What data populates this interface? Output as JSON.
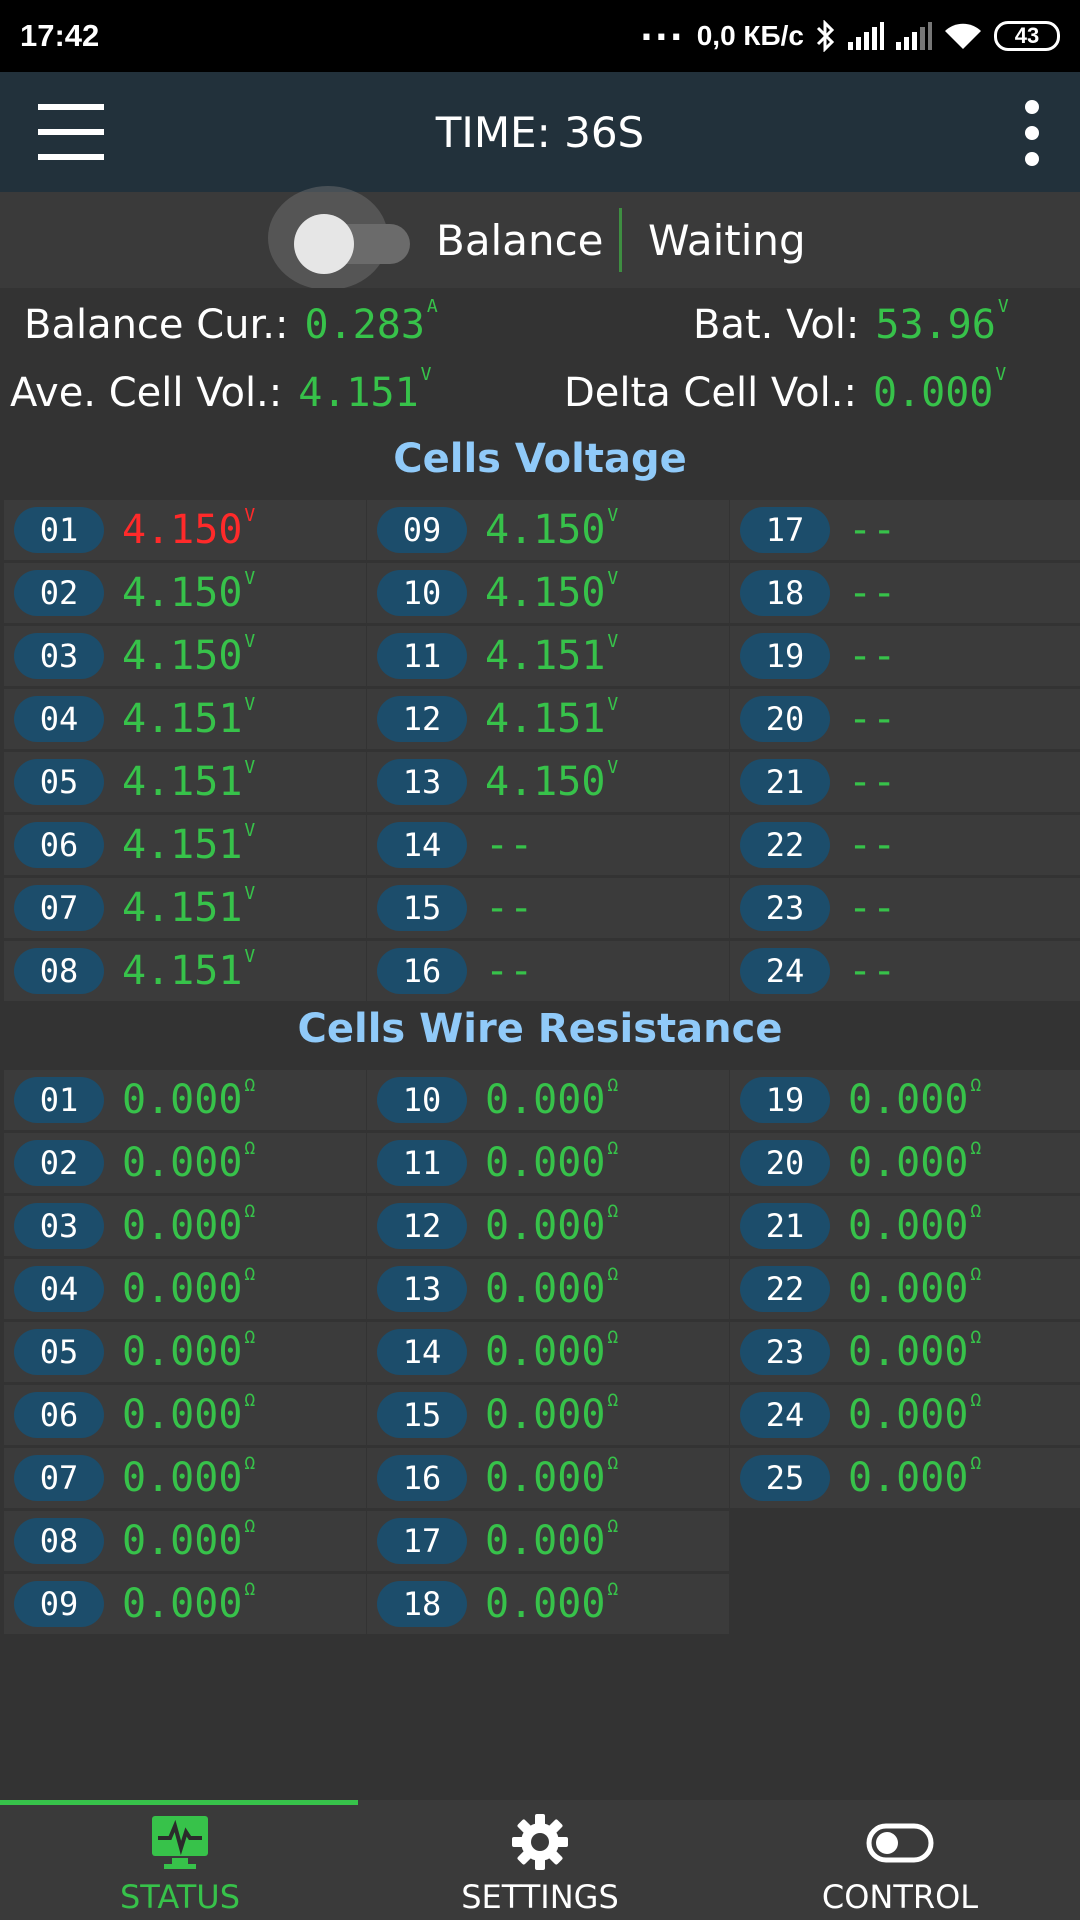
{
  "status_bar": {
    "time": "17:42",
    "dots": "...",
    "speed": "0,0 КБ/с",
    "battery": "43"
  },
  "app_bar": {
    "title": "TIME: 36S"
  },
  "balance": {
    "label": "Balance",
    "state": "Waiting",
    "switch_on": false
  },
  "stats": {
    "balance_cur": {
      "label": "Balance Cur.:",
      "value": "0.283",
      "unit": "A"
    },
    "bat_vol": {
      "label": "Bat. Vol:",
      "value": "53.96",
      "unit": "V"
    },
    "ave_cell_vol": {
      "label": "Ave. Cell Vol.:",
      "value": "4.151",
      "unit": "V"
    },
    "delta_cell_vol": {
      "label": "Delta Cell Vol.:",
      "value": "0.000",
      "unit": "V"
    }
  },
  "cells_voltage": {
    "title": "Cells Voltage",
    "unit": "V",
    "cells": [
      {
        "id": "01",
        "value": "4.150",
        "alert": true
      },
      {
        "id": "02",
        "value": "4.150"
      },
      {
        "id": "03",
        "value": "4.150"
      },
      {
        "id": "04",
        "value": "4.151"
      },
      {
        "id": "05",
        "value": "4.151"
      },
      {
        "id": "06",
        "value": "4.151"
      },
      {
        "id": "07",
        "value": "4.151"
      },
      {
        "id": "08",
        "value": "4.151"
      },
      {
        "id": "09",
        "value": "4.150"
      },
      {
        "id": "10",
        "value": "4.150"
      },
      {
        "id": "11",
        "value": "4.151"
      },
      {
        "id": "12",
        "value": "4.151"
      },
      {
        "id": "13",
        "value": "4.150"
      },
      {
        "id": "14",
        "value": "--"
      },
      {
        "id": "15",
        "value": "--"
      },
      {
        "id": "16",
        "value": "--"
      },
      {
        "id": "17",
        "value": "--"
      },
      {
        "id": "18",
        "value": "--"
      },
      {
        "id": "19",
        "value": "--"
      },
      {
        "id": "20",
        "value": "--"
      },
      {
        "id": "21",
        "value": "--"
      },
      {
        "id": "22",
        "value": "--"
      },
      {
        "id": "23",
        "value": "--"
      },
      {
        "id": "24",
        "value": "--"
      }
    ]
  },
  "cells_resistance": {
    "title": "Cells Wire Resistance",
    "unit": "Ω",
    "cells": [
      {
        "id": "01",
        "value": "0.000"
      },
      {
        "id": "02",
        "value": "0.000"
      },
      {
        "id": "03",
        "value": "0.000"
      },
      {
        "id": "04",
        "value": "0.000"
      },
      {
        "id": "05",
        "value": "0.000"
      },
      {
        "id": "06",
        "value": "0.000"
      },
      {
        "id": "07",
        "value": "0.000"
      },
      {
        "id": "08",
        "value": "0.000"
      },
      {
        "id": "09",
        "value": "0.000"
      },
      {
        "id": "10",
        "value": "0.000"
      },
      {
        "id": "11",
        "value": "0.000"
      },
      {
        "id": "12",
        "value": "0.000"
      },
      {
        "id": "13",
        "value": "0.000"
      },
      {
        "id": "14",
        "value": "0.000"
      },
      {
        "id": "15",
        "value": "0.000"
      },
      {
        "id": "16",
        "value": "0.000"
      },
      {
        "id": "17",
        "value": "0.000"
      },
      {
        "id": "18",
        "value": "0.000"
      },
      {
        "id": "19",
        "value": "0.000"
      },
      {
        "id": "20",
        "value": "0.000"
      },
      {
        "id": "21",
        "value": "0.000"
      },
      {
        "id": "22",
        "value": "0.000"
      },
      {
        "id": "23",
        "value": "0.000"
      },
      {
        "id": "24",
        "value": "0.000"
      },
      {
        "id": "25",
        "value": "0.000"
      }
    ]
  },
  "bottom_nav": {
    "active": "status",
    "items": [
      {
        "key": "status",
        "label": "STATUS",
        "icon": "monitor-pulse-icon"
      },
      {
        "key": "settings",
        "label": "SETTINGS",
        "icon": "gear-icon"
      },
      {
        "key": "control",
        "label": "CONTROL",
        "icon": "toggle-icon"
      }
    ]
  },
  "colors": {
    "green": "#37c24a",
    "red": "#ff2a2a",
    "badge": "#1c4d6b",
    "title_blue": "#90caf9",
    "appbar": "#22313b"
  }
}
